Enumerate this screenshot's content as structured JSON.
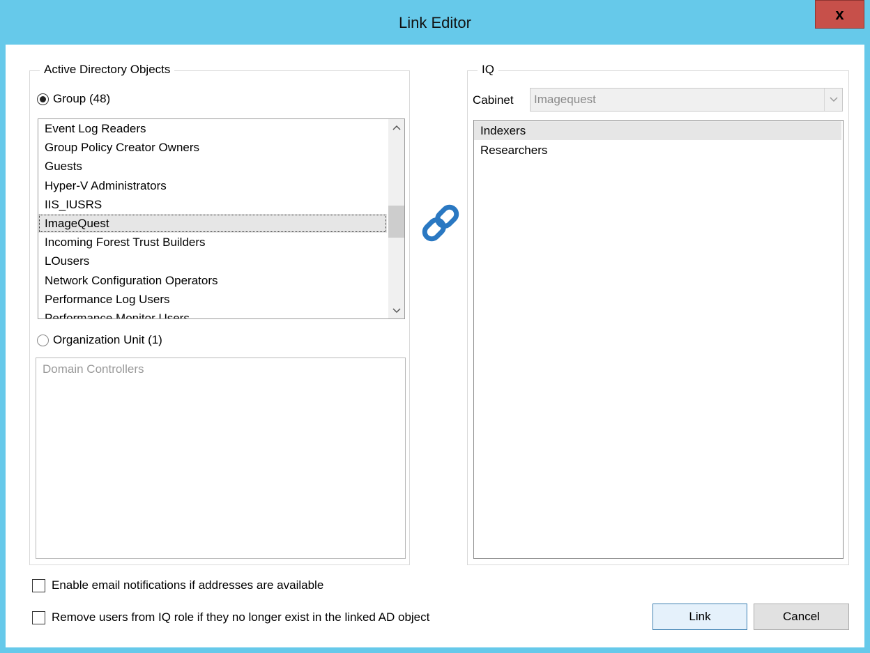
{
  "window": {
    "title": "Link Editor",
    "close_label": "x"
  },
  "ad_group": {
    "legend": "Active Directory Objects",
    "group_radio_label": "Group (48)",
    "groups": [
      "Event Log Readers",
      "Group Policy Creator Owners",
      "Guests",
      "Hyper-V Administrators",
      "IIS_IUSRS",
      "ImageQuest",
      "Incoming Forest Trust Builders",
      "LOusers",
      "Network Configuration Operators",
      "Performance Log Users",
      "Performance Monitor Users"
    ],
    "selected_group": "ImageQuest",
    "ou_radio_label": "Organization Unit (1)",
    "ous": [
      "Domain Controllers"
    ]
  },
  "iq_group": {
    "legend": "IQ",
    "cabinet_label": "Cabinet",
    "cabinet_value": "Imagequest",
    "roles": [
      "Indexers",
      "Researchers"
    ],
    "selected_role": "Indexers"
  },
  "options": {
    "email_label": "Enable email notifications if addresses are available",
    "remove_label": "Remove users from IQ role if they no longer exist in the linked AD object"
  },
  "buttons": {
    "link": "Link",
    "cancel": "Cancel"
  },
  "colors": {
    "title_bar": "#66c9ea",
    "close_button": "#c7504a",
    "link_icon": "#2a78c2"
  },
  "icons": {
    "link": "link-chain-icon",
    "close": "close-icon",
    "scroll_up": "chevron-up-icon",
    "scroll_down": "chevron-down-icon",
    "dropdown": "chevron-down-icon"
  }
}
